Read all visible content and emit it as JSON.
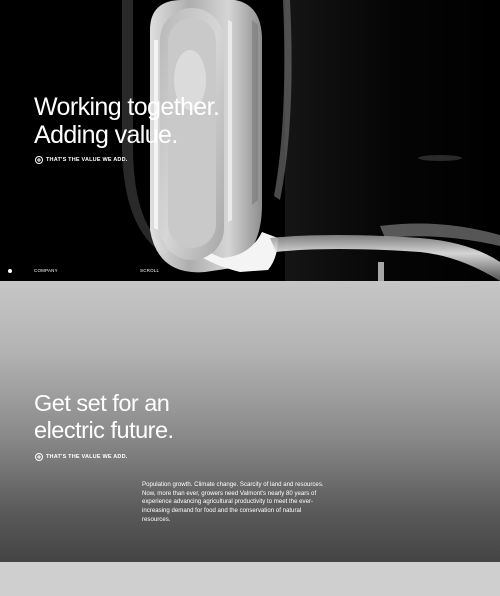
{
  "hero": {
    "title_line1": "Working together.",
    "title_line2": "Adding value.",
    "cta_label": "THAT'S THE VALUE WE ADD.",
    "cta_icon": "plus-circle-icon",
    "footer": {
      "company_label": "COMPANY",
      "scroll_label": "SCROLL"
    }
  },
  "section": {
    "title_line1": "Get set for an",
    "title_line2": "electric future.",
    "cta_label": "THAT'S THE VALUE WE ADD.",
    "cta_icon": "plus-circle-icon",
    "body": "Population growth. Climate change. Scarcity of land and resources. Now, more than ever, growers need Valmont's nearly 80 years of experience advancing agricultural productivity to meet the ever-increasing demand for food and the conservation of natural resources."
  },
  "colors": {
    "hero_bg": "#000000",
    "text": "#ffffff",
    "section_gradient_top": "#c6c6c6",
    "section_gradient_bottom": "#444444",
    "bottom_band": "#cfcfcf"
  }
}
